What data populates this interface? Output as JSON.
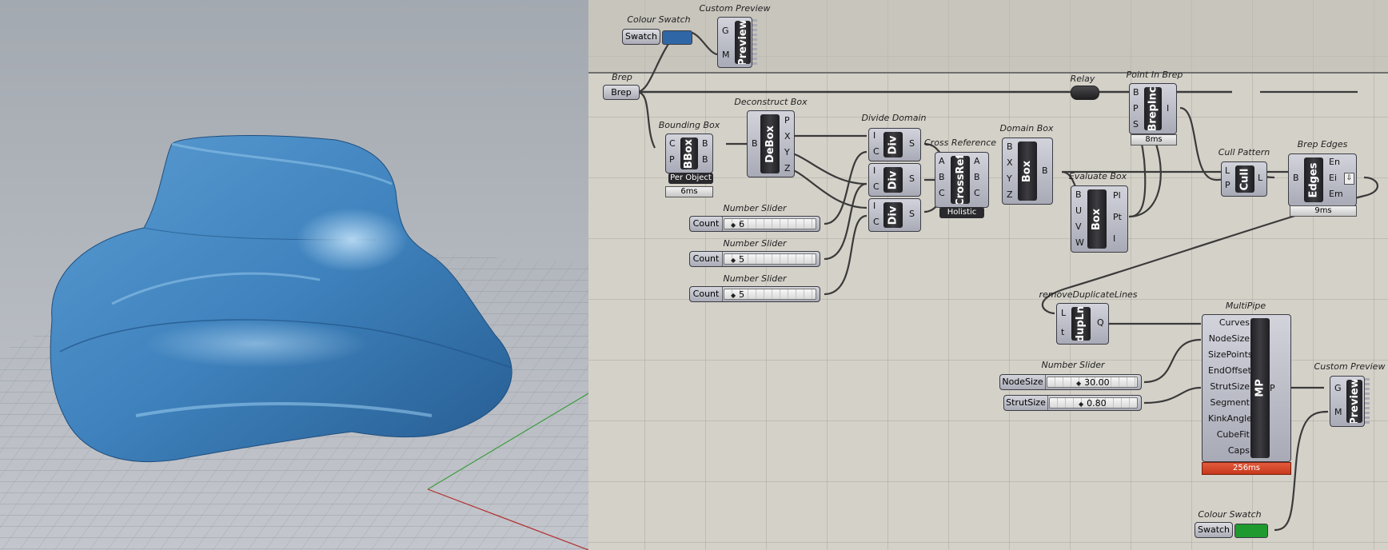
{
  "canvas": {
    "group_swatch": {
      "title": "Colour Swatch",
      "label": "Swatch",
      "color": "#2f67a6"
    },
    "group_preview": {
      "title": "Custom Preview",
      "inputs": [
        "G",
        "M"
      ],
      "core": "Preview"
    },
    "brep": {
      "title": "Brep",
      "label": "Brep"
    },
    "relay": {
      "title": "Relay"
    },
    "point_in_brep": {
      "title": "Point In Brep",
      "inputs": [
        "B",
        "P",
        "S"
      ],
      "output": "I",
      "core": "BrepInc",
      "time": "8ms"
    },
    "deconstruct_box": {
      "title": "Deconstruct Box",
      "input": "B",
      "outputs": [
        "P",
        "X",
        "Y",
        "Z"
      ],
      "core": "DeBox"
    },
    "bounding_box": {
      "title": "Bounding Box",
      "inputs": [
        "C",
        "P"
      ],
      "outputs": [
        "B",
        "B"
      ],
      "core": "BBox",
      "badge": "Per Object",
      "time": "6ms"
    },
    "divide_domain": {
      "title": "Divide Domain",
      "inputs": [
        "I",
        "C"
      ],
      "output": "S",
      "core": "Div"
    },
    "cross_reference": {
      "title": "Cross Reference",
      "inputs": [
        "A",
        "B",
        "C"
      ],
      "outputs": [
        "A",
        "B",
        "C"
      ],
      "core": "CrossRef",
      "badge": "Holistic"
    },
    "domain_box": {
      "title": "Domain Box",
      "inputs": [
        "B",
        "X",
        "Y",
        "Z"
      ],
      "output": "B",
      "core": "Box"
    },
    "evaluate_box": {
      "title": "Evaluate Box",
      "inputs": [
        "B",
        "U",
        "V",
        "W"
      ],
      "outputs": [
        "Pl",
        "Pt",
        "I"
      ],
      "core": "Box"
    },
    "cull_pattern": {
      "title": "Cull Pattern",
      "inputs": [
        "L",
        "P"
      ],
      "output": "L",
      "core": "Cull"
    },
    "brep_edges": {
      "title": "Brep Edges",
      "input": "B",
      "outputs": [
        "En",
        "Ei",
        "Em"
      ],
      "core": "Edges",
      "time": "9ms"
    },
    "sliders": [
      {
        "title": "Number Slider",
        "label": "Count",
        "value": "6"
      },
      {
        "title": "Number Slider",
        "label": "Count",
        "value": "5"
      },
      {
        "title": "Number Slider",
        "label": "Count",
        "value": "5"
      }
    ],
    "remove_dup": {
      "title": "removeDuplicateLines",
      "inputs": [
        "L",
        "t"
      ],
      "output": "Q",
      "core": "dupLn"
    },
    "multipipe": {
      "title": "MultiPipe",
      "inputs": [
        "Curves",
        "NodeSize",
        "SizePoints",
        "EndOffset",
        "StrutSize",
        "Segment",
        "KinkAngle",
        "CubeFit",
        "Caps"
      ],
      "output": "P",
      "core": "MP",
      "time": "256ms"
    },
    "slider_nodesize": {
      "title": "Number Slider",
      "label": "NodeSize",
      "value": "30.00"
    },
    "slider_strutsize": {
      "label": "StrutSize",
      "value": "0.80"
    },
    "custom_preview_2": {
      "title": "Custom Preview",
      "inputs": [
        "G",
        "M"
      ],
      "core": "Preview"
    },
    "colour_swatch_2": {
      "title": "Colour Swatch",
      "label": "Swatch",
      "color": "#1f9a2e"
    }
  },
  "viewport": {
    "model_color": "#3f82bd",
    "background_top": "#a3a9b0",
    "background_bottom": "#c3c6cc"
  }
}
